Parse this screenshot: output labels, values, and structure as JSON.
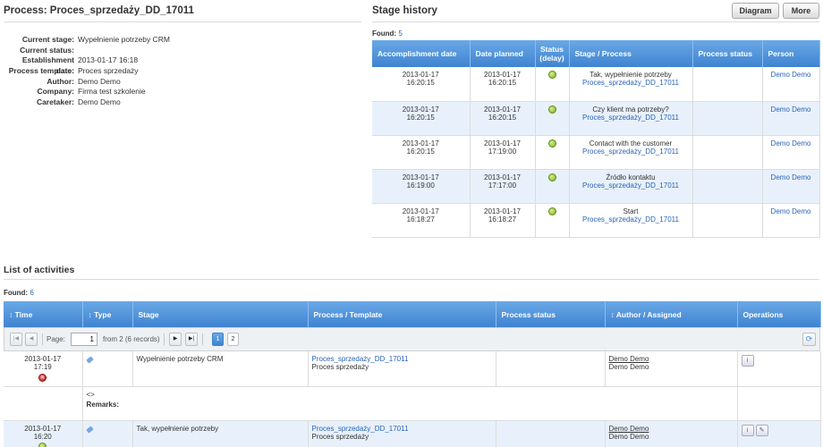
{
  "process": {
    "title": "Process: Proces_sprzedaży_DD_17011",
    "details": [
      {
        "label": "Current stage:",
        "value": "Wypełnienie potrzeby CRM"
      },
      {
        "label": "Current status:",
        "value": ""
      },
      {
        "label": "Establishment date:",
        "value": "2013-01-17 16:18"
      },
      {
        "label": "Process template:",
        "value": "Proces sprzedaży"
      },
      {
        "label": "Author:",
        "value": "Demo Demo"
      },
      {
        "label": "Company:",
        "value": "Firma test szkolenie"
      },
      {
        "label": "Caretaker:",
        "value": "Demo Demo"
      }
    ]
  },
  "stage_history": {
    "title": "Stage history",
    "buttons": {
      "diagram": "Diagram",
      "more": "More"
    },
    "found_label": "Found:",
    "found_count": "5",
    "columns": [
      "Accomplishment date",
      "Date planned",
      "Status (delay)",
      "Stage / Process",
      "Process status",
      "Person"
    ],
    "rows": [
      {
        "acc_date": "2013-01-17",
        "acc_time": "16:20:15",
        "plan_date": "2013-01-17",
        "plan_time": "16:20:15",
        "stage": "Tak, wypełnienie potrzeby",
        "process": "Proces_sprzedaży_DD_17011",
        "process_status": "",
        "person": "Demo Demo"
      },
      {
        "acc_date": "2013-01-17",
        "acc_time": "16:20:15",
        "plan_date": "2013-01-17",
        "plan_time": "16:20:15",
        "stage": "Czy klient ma potrzeby?",
        "process": "Proces_sprzedaży_DD_17011",
        "process_status": "",
        "person": "Demo Demo"
      },
      {
        "acc_date": "2013-01-17",
        "acc_time": "16:20:15",
        "plan_date": "2013-01-17",
        "plan_time": "17:19:00",
        "stage": "Contact with the customer",
        "process": "Proces_sprzedaży_DD_17011",
        "process_status": "",
        "person": "Demo Demo"
      },
      {
        "acc_date": "2013-01-17",
        "acc_time": "16:19:00",
        "plan_date": "2013-01-17",
        "plan_time": "17:17:00",
        "stage": "Źródło kontaktu",
        "process": "Proces_sprzedaży_DD_17011",
        "process_status": "",
        "person": "Demo Demo"
      },
      {
        "acc_date": "2013-01-17",
        "acc_time": "16:18:27",
        "plan_date": "2013-01-17",
        "plan_time": "16:18:27",
        "stage": "Start",
        "process": "Proces_sprzedaży_DD_17011",
        "process_status": "",
        "person": "Demo Demo"
      }
    ]
  },
  "activities": {
    "title": "List of activities",
    "found_label": "Found:",
    "found_count": "6",
    "columns": [
      "Time",
      "Type",
      "Stage",
      "Process / Template",
      "Process status",
      "Author / Assigned",
      "Operations"
    ],
    "pager": {
      "page_label": "Page:",
      "page_value": "1",
      "from_text": "from 2 (6 records)",
      "pages": [
        "1",
        "2"
      ]
    },
    "rows": [
      {
        "date": "2013-01-17",
        "time": "17:19",
        "stage": "Wypełnienie potrzeby CRM",
        "process": "Proces_sprzedaży_DD_17011",
        "template": "Proces sprzedaży",
        "author": "Demo Demo",
        "assigned": "Demo Demo",
        "remarks_symbol": "<>",
        "remarks_label": "Remarks:"
      },
      {
        "date": "2013-01-17",
        "time": "16:20",
        "stage": "Tak, wypełnienie potrzeby",
        "process": "Proces_sprzedaży_DD_17011",
        "template": "Proces sprzedaży",
        "author": "Demo Demo",
        "assigned": "Demo Demo"
      }
    ]
  },
  "colors": {
    "header_blue": "#4a8fd8",
    "link": "#2a62b8",
    "stripe": "#e8f1fb"
  }
}
